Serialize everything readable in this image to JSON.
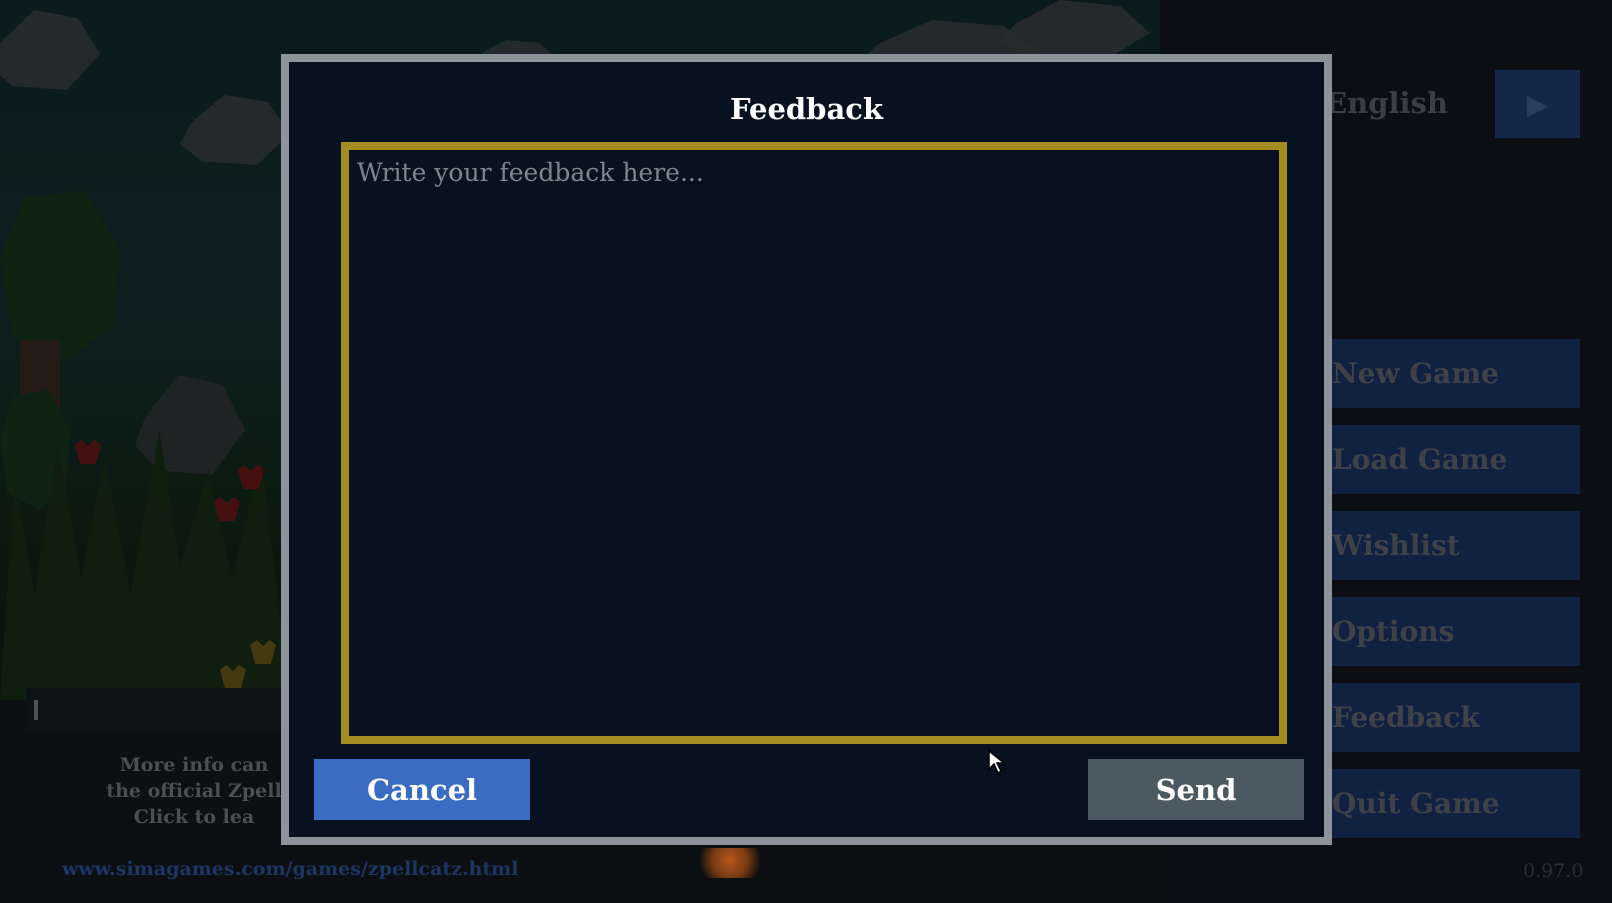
{
  "scene": {
    "info_lines": [
      "More info can",
      "the official Zpell",
      "Click to lea"
    ],
    "url": "www.simagames.com/games/zpellcatz.html"
  },
  "side_menu": {
    "language": "English",
    "language_next_icon": "play-triangle-icon",
    "buttons": [
      "New Game",
      "Load Game",
      "Wishlist",
      "Options",
      "Feedback",
      "Quit Game"
    ],
    "version": "0.97.0"
  },
  "modal": {
    "title": "Feedback",
    "textarea_placeholder": "Write your feedback here...",
    "textarea_value": "",
    "cancel_label": "Cancel",
    "send_label": "Send"
  },
  "colors": {
    "modal_bg": "#071120",
    "modal_border": "#8d939b",
    "textarea_border": "#a48c20",
    "cancel_bg": "#3a6cc2",
    "send_bg": "#4b5962"
  }
}
